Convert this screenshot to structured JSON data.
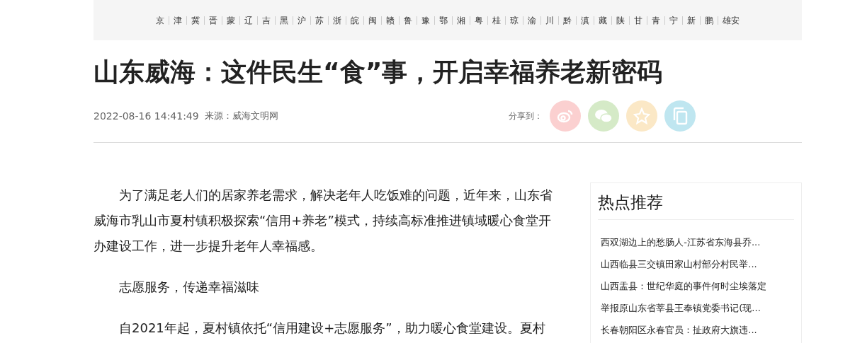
{
  "regions": [
    "京",
    "津",
    "冀",
    "晋",
    "蒙",
    "辽",
    "吉",
    "黑",
    "沪",
    "苏",
    "浙",
    "皖",
    "闽",
    "赣",
    "鲁",
    "豫",
    "鄂",
    "湘",
    "粤",
    "桂",
    "琼",
    "渝",
    "川",
    "黔",
    "滇",
    "藏",
    "陕",
    "甘",
    "青",
    "宁",
    "新",
    "鹏",
    "雄安"
  ],
  "article": {
    "title": "山东威海：这件民生“食”事，开启幸福养老新密码",
    "datetime": "2022-08-16 14:41:49",
    "source": "来源：威海文明网",
    "share_label": "分享到：",
    "share_buttons": [
      {
        "kind": "weibo",
        "color": "#fbd0d0"
      },
      {
        "kind": "wechat",
        "color": "#d5eac7"
      },
      {
        "kind": "qzone",
        "color": "#fbe8c6"
      },
      {
        "kind": "copy",
        "color": "#bfe6f0"
      }
    ],
    "paragraphs": [
      "为了满足老人们的居家养老需求，解决老年人吃饭难的问题，近年来，山东省威海市乳山市夏村镇积极探索“信用+养老”模式，持续高标准推进镇域暖心食堂开办建设工作，进一步提升老年人幸福感。",
      "志愿服务，传递幸福滋味",
      "自2021年起，夏村镇依托“信用建设+志愿服务”，助力暖心食堂建设。夏村"
    ]
  },
  "hot": {
    "title": "热点推荐",
    "items": [
      "西双湖边上的愁肠人-江苏省东海县乔...",
      "山西临县三交镇田家山村部分村民举...",
      "山西盂县：世纪华庭的事件何时尘埃落定",
      "举报原山东省莘县王奉镇党委书记(现...",
      "长春朝阳区永春官员：扯政府大旗违..."
    ]
  }
}
